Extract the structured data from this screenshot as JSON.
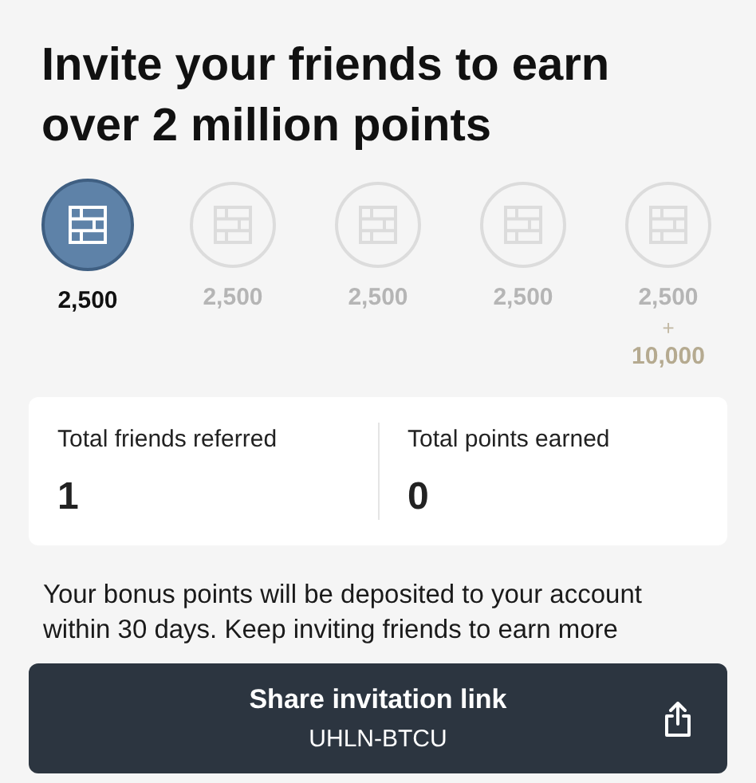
{
  "title": "Invite your friends to earn over 2 million points",
  "milestones": [
    {
      "kind": "standard",
      "selected": true,
      "points": "2,500"
    },
    {
      "kind": "standard",
      "selected": false,
      "points": "2,500"
    },
    {
      "kind": "standard",
      "selected": false,
      "points": "2,500"
    },
    {
      "kind": "standard",
      "selected": false,
      "points": "2,500"
    },
    {
      "kind": "bonus",
      "selected": false,
      "points": "2,500",
      "plus": "+",
      "bonus": "10,000"
    }
  ],
  "stats": [
    {
      "label": "Total friends referred",
      "value": "1"
    },
    {
      "label": "Total points earned",
      "value": "0"
    }
  ],
  "note": "Your bonus points will be deposited to your account within 30 days. Keep inviting friends to earn more",
  "share_button": {
    "label": "Share invitation link",
    "code": "UHLN-BTCU"
  }
}
